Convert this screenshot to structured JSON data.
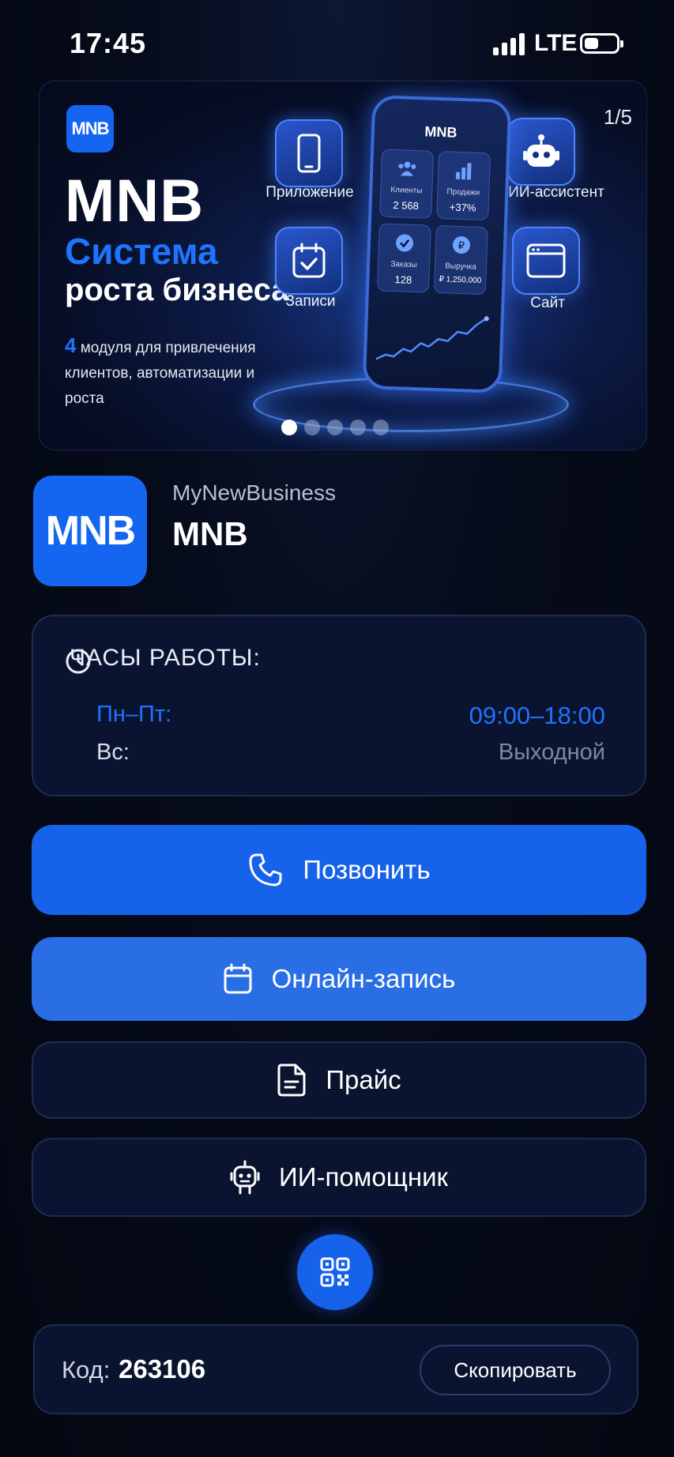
{
  "status_bar": {
    "time": "17:45",
    "network": "LTE"
  },
  "banner": {
    "counter": "1/5",
    "logo_text": "MNB",
    "brand": "MNB",
    "line2": "Система",
    "line3": "роста бизнеса",
    "desc_number": "4",
    "desc_text": " модуля для привлечения клиентов, автоматизации и роста",
    "modules": [
      "Приложение",
      "ИИ-ассистент",
      "Записи",
      "Сайт"
    ],
    "phone": {
      "title": "MNB",
      "tiles": [
        {
          "label": "Клиенты",
          "value": "2 568"
        },
        {
          "label": "Продажи",
          "value": "+37%"
        },
        {
          "label": "Заказы",
          "value": "128"
        },
        {
          "label": "Выручка",
          "value": "₽ 1,250,000"
        }
      ]
    },
    "slides_total": 5,
    "active_slide": 1
  },
  "profile": {
    "logo_text": "MNB",
    "subtitle": "MyNewBusiness",
    "name": "MNB"
  },
  "hours": {
    "title": "ЧАСЫ РАБОТЫ:",
    "rows": [
      {
        "days": "Пн–Пт:",
        "time": "09:00–18:00"
      },
      {
        "days": "Вс:",
        "time": "Выходной"
      }
    ]
  },
  "actions": {
    "call": "Позвонить",
    "booking": "Онлайн-запись",
    "price": "Прайс",
    "assistant": "ИИ-помощник"
  },
  "code": {
    "label": "Код:",
    "value": "263106",
    "copy": "Скопировать"
  },
  "colors": {
    "accent": "#1662ea",
    "background": "#060b1a",
    "card": "#0a1430",
    "accent_text": "#1f74ff"
  }
}
